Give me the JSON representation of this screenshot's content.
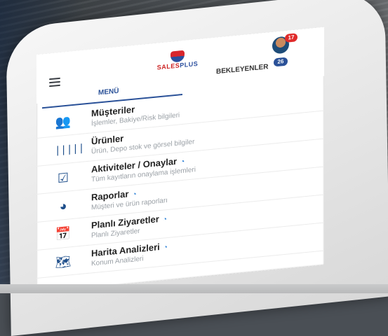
{
  "header": {
    "logo_text_a": "SALES",
    "logo_text_b": "PLUS",
    "notification_count": "17"
  },
  "tabs": [
    {
      "label": "MENÜ"
    },
    {
      "label": "BEKLEYENLER",
      "badge": "26"
    }
  ],
  "menu": [
    {
      "title": "Müşteriler",
      "subtitle": "İşlemler, Bakiye/Risk bilgileri",
      "icon": "people-icon",
      "wifi": false
    },
    {
      "title": "Ürünler",
      "subtitle": "Ürün, Depo stok ve görsel bilgiler",
      "icon": "barcode-icon",
      "wifi": false
    },
    {
      "title": "Aktiviteler / Onaylar",
      "subtitle": "Tüm kayıtların onaylama işlemleri",
      "icon": "checkbox-icon",
      "wifi": true
    },
    {
      "title": "Raporlar",
      "subtitle": "Müşteri ve ürün raporları",
      "icon": "pie-chart-icon",
      "wifi": true
    },
    {
      "title": "Planlı Ziyaretler",
      "subtitle": "Planlı Ziyaretler",
      "icon": "calendar-icon",
      "wifi": true
    },
    {
      "title": "Harita Analizleri",
      "subtitle": "Konum Analizleri",
      "icon": "map-icon",
      "wifi": true
    }
  ],
  "colors": {
    "accent": "#2a5198",
    "badge_red": "#e02b2b",
    "icon_blue": "#1f4f8b"
  }
}
